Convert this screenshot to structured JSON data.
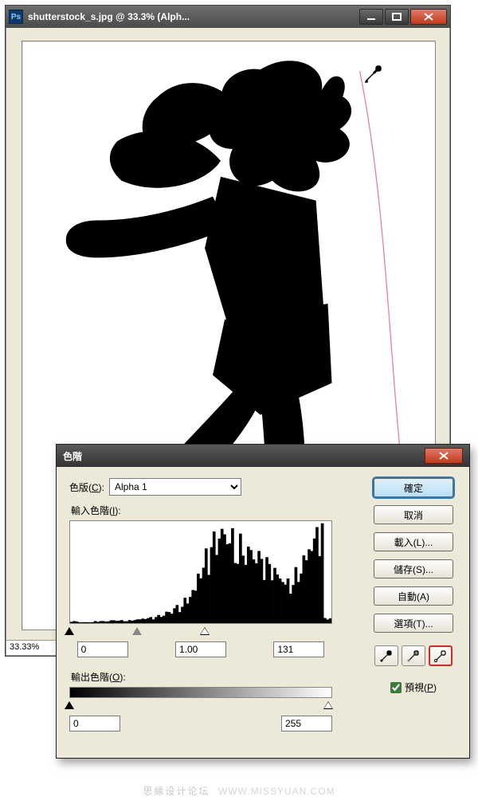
{
  "ps_window": {
    "title": "shutterstock_s.jpg @ 33.3% (Alph...",
    "icon_letter": "Ps",
    "status_zoom": "33.33%"
  },
  "cursor": {
    "name": "eyedropper"
  },
  "levels": {
    "title": "色階",
    "channel_label_pre": "色版(",
    "channel_key": "C",
    "channel_label_post": "):",
    "channel_value": "Alpha 1",
    "input_label_pre": "輸入色階(",
    "input_key": "I",
    "input_label_post": "):",
    "input_values": {
      "shadow": "0",
      "mid": "1.00",
      "highlight": "131"
    },
    "output_label_pre": "輸出色階(",
    "output_key": "O",
    "output_label_post": "):",
    "output_values": {
      "shadow": "0",
      "highlight": "255"
    },
    "buttons": {
      "ok": "確定",
      "cancel": "取消",
      "load": "載入(L)...",
      "save": "儲存(S)...",
      "auto": "自動(A)",
      "options": "選項(T)..."
    },
    "preview_label_pre": "預視(",
    "preview_key": "P",
    "preview_label_post": ")",
    "preview_checked": true
  },
  "watermark": {
    "site": "思縁设计论坛",
    "url": "WWW.MISSYUAN.COM"
  },
  "chart_data": {
    "type": "bar",
    "title": "Histogram",
    "xlabel": "",
    "ylabel": "",
    "xlim": [
      0,
      255
    ],
    "ylim": [
      0,
      1
    ],
    "categories": [
      0,
      8,
      16,
      24,
      32,
      40,
      48,
      56,
      64,
      72,
      80,
      88,
      96,
      104,
      112,
      120,
      128,
      136,
      144,
      152,
      160,
      168,
      176,
      184,
      192,
      200,
      208,
      216,
      224,
      232,
      240,
      248,
      255
    ],
    "values": [
      0.02,
      0.01,
      0.01,
      0.02,
      0.02,
      0.03,
      0.03,
      0.03,
      0.04,
      0.05,
      0.06,
      0.08,
      0.12,
      0.18,
      0.25,
      0.35,
      0.55,
      0.75,
      0.9,
      0.98,
      0.95,
      0.88,
      0.8,
      0.72,
      0.65,
      0.58,
      0.5,
      0.45,
      0.55,
      0.7,
      0.85,
      0.98,
      0.05
    ]
  }
}
